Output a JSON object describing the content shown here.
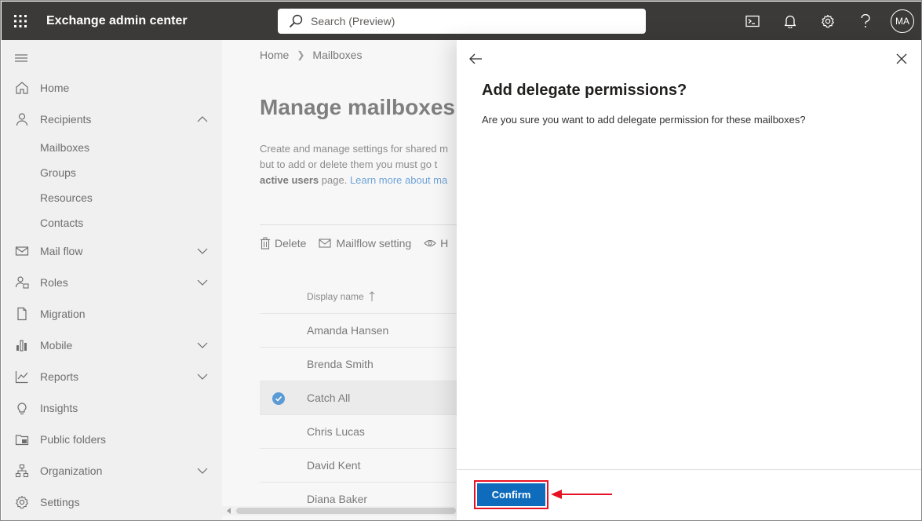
{
  "topbar": {
    "app_title": "Exchange admin center",
    "search_placeholder": "Search (Preview)",
    "avatar_initials": "MA",
    "bg_color": "#3b3a39"
  },
  "nav": {
    "items": [
      {
        "label": "Home",
        "icon": "home-icon"
      },
      {
        "label": "Recipients",
        "icon": "person-icon",
        "expanded": true
      },
      {
        "label": "Mail flow",
        "icon": "mail-icon"
      },
      {
        "label": "Roles",
        "icon": "roles-icon"
      },
      {
        "label": "Migration",
        "icon": "migration-icon"
      },
      {
        "label": "Mobile",
        "icon": "mobile-icon"
      },
      {
        "label": "Reports",
        "icon": "reports-icon"
      },
      {
        "label": "Insights",
        "icon": "lightbulb-icon"
      },
      {
        "label": "Public folders",
        "icon": "folder-icon"
      },
      {
        "label": "Organization",
        "icon": "organization-icon"
      },
      {
        "label": "Settings",
        "icon": "gear-icon"
      }
    ],
    "recipients_sub": [
      "Mailboxes",
      "Groups",
      "Resources",
      "Contacts"
    ]
  },
  "main": {
    "breadcrumb": [
      "Home",
      "Mailboxes"
    ],
    "title": "Manage mailboxes",
    "desc_line1": "Create and manage settings for shared m",
    "desc_line2": "but to add or delete them you must go t",
    "desc_bold": "active users",
    "desc_line3_rest": " page. ",
    "desc_link": "Learn more about ma",
    "commands": {
      "delete": "Delete",
      "mailflow": "Mailflow setting",
      "more": "H"
    },
    "column_header": "Display name",
    "rows": [
      {
        "name": "Amanda Hansen",
        "selected": false
      },
      {
        "name": "Brenda Smith",
        "selected": false
      },
      {
        "name": "Catch All",
        "selected": true
      },
      {
        "name": "Chris Lucas",
        "selected": false
      },
      {
        "name": "David Kent",
        "selected": false
      },
      {
        "name": "Diana Baker",
        "selected": false
      }
    ]
  },
  "panel": {
    "title": "Add delegate permissions?",
    "message": "Are you sure you want to add delegate permission for these mailboxes?",
    "confirm_label": "Confirm",
    "accent": "#0f6cbd",
    "highlight_color": "#e81123"
  }
}
